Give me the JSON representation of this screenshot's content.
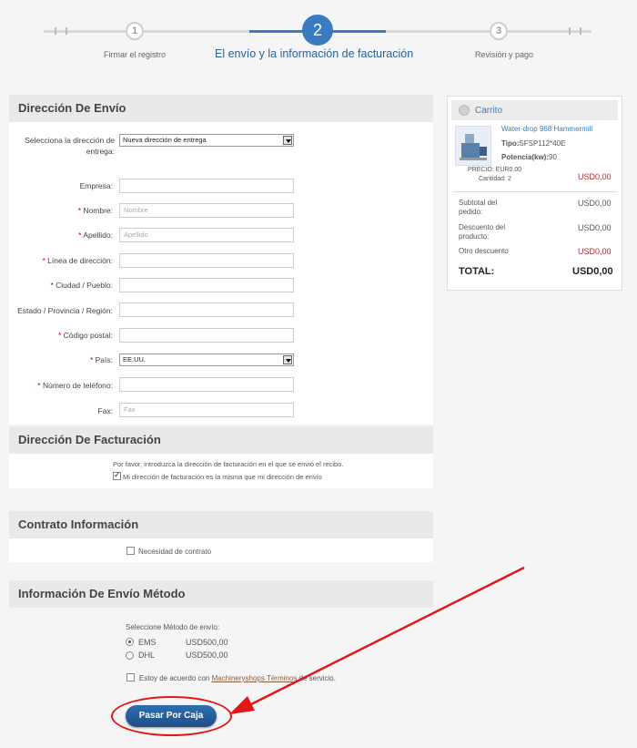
{
  "stepper": {
    "steps": [
      {
        "number": "1",
        "label": "Firmar el registro"
      },
      {
        "number": "2",
        "label": "El envío y la información de facturación"
      },
      {
        "number": "3",
        "label": "Revisión y pago"
      }
    ]
  },
  "shipping": {
    "title": "Dirección De Envío",
    "select_address_label": "Selecciona la dirección de entrega:",
    "select_address_value": "Nueva dirección de entrega",
    "fields": [
      {
        "label": "Empresa:",
        "required": false,
        "placeholder": ""
      },
      {
        "label": "Nombre:",
        "required": true,
        "placeholder": "Nombre"
      },
      {
        "label": "Apellido:",
        "required": true,
        "placeholder": "Apellido"
      },
      {
        "label": "Línea de dirección:",
        "required": true,
        "placeholder": ""
      },
      {
        "label": "Ciudad / Pueblo:",
        "required": true,
        "placeholder": ""
      },
      {
        "label": "Estado / Provincia / Región:",
        "required": false,
        "placeholder": ""
      },
      {
        "label": "Código postal:",
        "required": true,
        "placeholder": ""
      },
      {
        "label": "País:",
        "required": true,
        "placeholder": ""
      },
      {
        "label": "Número de teléfono:",
        "required": true,
        "placeholder": ""
      },
      {
        "label": "Fax:",
        "required": false,
        "placeholder": "Fax"
      }
    ],
    "country_value": "EE.UU.",
    "required_mark": "*"
  },
  "billing": {
    "title": "Dirección De Facturación",
    "intro": "Por favor, introduzca la dirección de facturación en el que se envió el recibo.",
    "same_address_label": "Mi dirección de facturación es la misma que mi dirección de envío"
  },
  "contract": {
    "title": "Contrato Información",
    "need_contract_label": "Necesidad de contrato"
  },
  "shipping_method": {
    "title": "Información De Envío Método",
    "prompt": "Seleccione Método de envío:",
    "options": [
      {
        "name": "EMS",
        "price": "USD500,00",
        "selected": true
      },
      {
        "name": "DHL",
        "price": "USD500,00",
        "selected": false
      }
    ],
    "terms_prefix": "Estoy de acuerdo con ",
    "terms_link": "Machineryshops Términos",
    "terms_suffix": " de servicio.",
    "checkout_label": "Pasar Por Caja"
  },
  "cart": {
    "title": "Carrito",
    "item_name": "Water-drop 968 Hammermill",
    "tipo_label": "Tipo:",
    "tipo_value": "SFSP112*40E",
    "potencia_label": "Potencia(kw):",
    "potencia_value": "90",
    "precio": "PRECIO: EUR0.00",
    "cantidad": "Cantidad: 2",
    "line_total": "USD0,00",
    "subtotal_label": "Subtotal del pedido:",
    "subtotal_value": "USD0,00",
    "discount_label": "Descuento del producto:",
    "discount_value": "USD0,00",
    "other_discount_label": "Otro descuento",
    "other_discount_value": "USD0,00",
    "total_label": "TOTAL:",
    "total_value": "USD0,00"
  },
  "colors": {
    "accent": "#3a7cc1",
    "annotation": "#e01818"
  }
}
